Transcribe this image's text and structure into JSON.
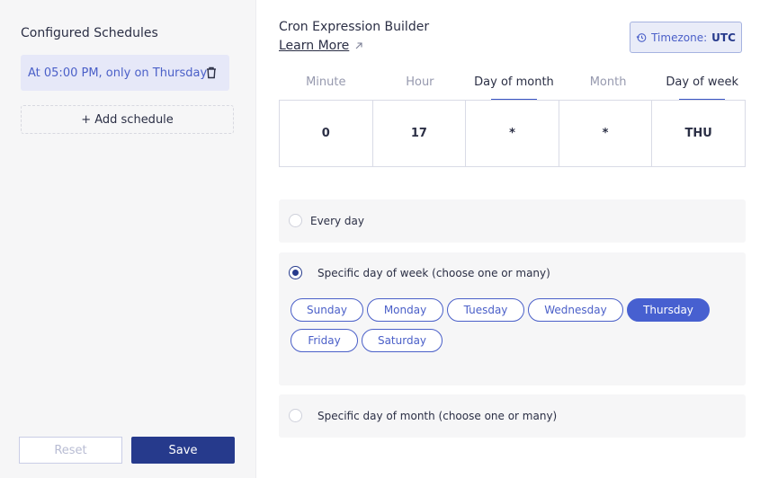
{
  "sidebar": {
    "title": "Configured Schedules",
    "schedules": [
      {
        "label": "At 05:00 PM, only on Thursday",
        "selected": true
      }
    ],
    "add_label": "+ Add schedule",
    "reset_label": "Reset",
    "save_label": "Save"
  },
  "main": {
    "title": "Cron Expression Builder",
    "learn_more": "Learn More",
    "timezone_label": "Timezone:",
    "timezone_value": "UTC",
    "fields": [
      {
        "label": "Minute",
        "value": "0",
        "active": false
      },
      {
        "label": "Hour",
        "value": "17",
        "active": false
      },
      {
        "label": "Day of month",
        "value": "*",
        "active": true
      },
      {
        "label": "Month",
        "value": "*",
        "active": false
      },
      {
        "label": "Day of week",
        "value": "THU",
        "active": true
      }
    ],
    "options": {
      "every_day": "Every day",
      "specific_week": "Specific day of week (choose one or many)",
      "specific_month": "Specific day of month (choose one or many)",
      "selected": "specific_week"
    },
    "days": [
      {
        "label": "Sunday",
        "selected": false
      },
      {
        "label": "Monday",
        "selected": false
      },
      {
        "label": "Tuesday",
        "selected": false
      },
      {
        "label": "Wednesday",
        "selected": false
      },
      {
        "label": "Thursday",
        "selected": true
      },
      {
        "label": "Friday",
        "selected": false
      },
      {
        "label": "Saturday",
        "selected": false
      }
    ]
  },
  "colors": {
    "accent": "#4760d0",
    "primary": "#263a8c",
    "sidebar_bg": "#f6f6f7"
  }
}
